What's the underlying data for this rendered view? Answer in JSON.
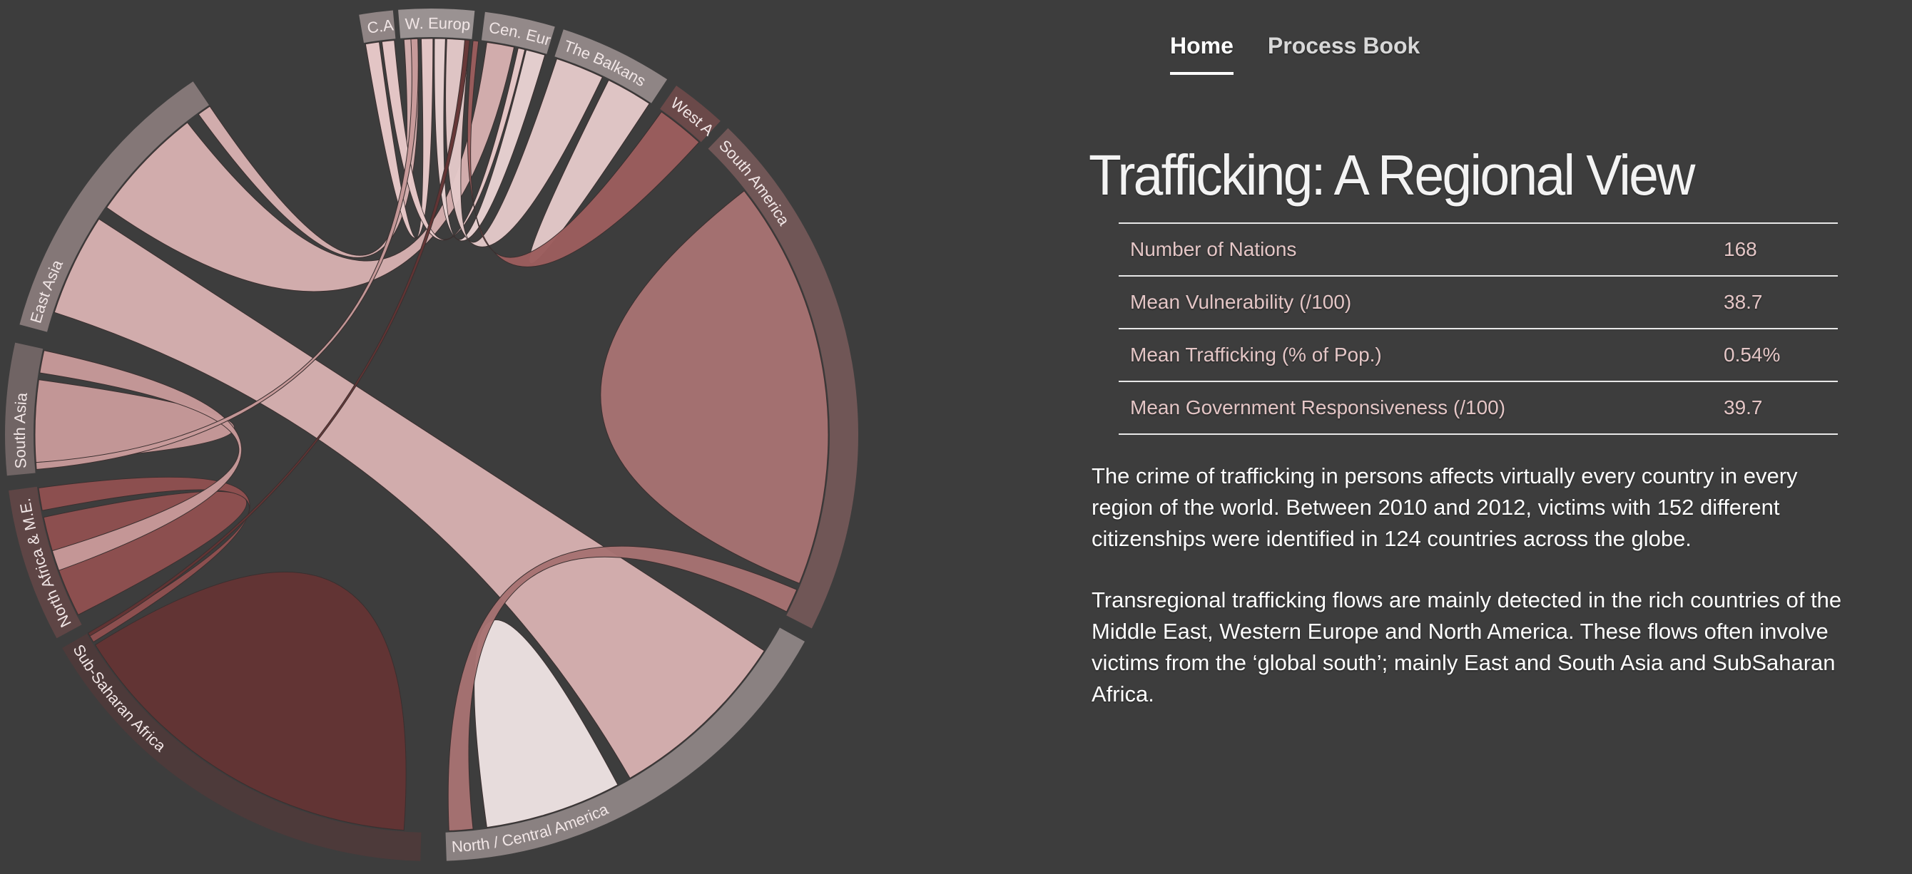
{
  "nav": {
    "items": [
      {
        "label": "Home",
        "active": true
      },
      {
        "label": "Process Book",
        "active": false
      }
    ]
  },
  "title": "Trafficking: A Regional View",
  "stats": [
    {
      "label": "Number of Nations",
      "value": "168"
    },
    {
      "label": "Mean Vulnerability (/100)",
      "value": "38.7"
    },
    {
      "label": "Mean Trafficking (% of Pop.)",
      "value": "0.54%"
    },
    {
      "label": "Mean Government Responsiveness (/100)",
      "value": "39.7"
    }
  ],
  "paragraphs": [
    "The crime of trafficking in persons affects virtually every country in every region of the world. Between 2010 and 2012, victims with 152 different citizenships were identified in 124 countries across the globe.",
    "Transregional trafficking flows are mainly detected in the rich countries of the Middle East, Western Europe and North America. These flows often involve victims from the ‘global south’; mainly East and South Asia and SubSaharan Africa."
  ],
  "chart_data": {
    "type": "chord",
    "groups": [
      {
        "label": "C.Asia",
        "color": "#e8c9c9",
        "ring": "#8f8484"
      },
      {
        "label": "W. Europe",
        "color": "#f5eeee",
        "ring": "#9a9292"
      },
      {
        "label": "Cen. Europe",
        "color": "#e8d2d2",
        "ring": "#938989"
      },
      {
        "label": "The Balkans",
        "color": "#e3c8c8",
        "ring": "#8f8585"
      },
      {
        "label": "West Africa",
        "color": "#9b5d5d",
        "ring": "#6a4949"
      },
      {
        "label": "South America",
        "color": "#a67272",
        "ring": "#705656"
      },
      {
        "label": "North / Central America",
        "color": "#ece1e1",
        "ring": "#8a8181"
      },
      {
        "label": "Sub-Saharan Africa",
        "color": "#633434",
        "ring": "#4d3a3a"
      },
      {
        "label": "North Africa & M.E.",
        "color": "#8e4f4f",
        "ring": "#5e4545"
      },
      {
        "label": "South Asia",
        "color": "#c69999",
        "ring": "#706464"
      },
      {
        "label": "East Asia",
        "color": "#d6b0b0",
        "ring": "#847777"
      }
    ],
    "ribbons": [
      {
        "source": "East Asia",
        "target": "Cen. Europe"
      },
      {
        "source": "East Asia",
        "target": "North / Central America"
      },
      {
        "source": "East Asia",
        "target": "W. Europe"
      },
      {
        "source": "C.Asia",
        "target": "W. Europe"
      },
      {
        "source": "C.Asia",
        "target": "Cen. Europe"
      },
      {
        "source": "Cen. Europe",
        "target": "W. Europe"
      },
      {
        "source": "The Balkans",
        "target": "W. Europe"
      },
      {
        "source": "The Balkans",
        "target": "The Balkans"
      },
      {
        "source": "West Africa",
        "target": "W. Europe"
      },
      {
        "source": "South America",
        "target": "South America"
      },
      {
        "source": "South America",
        "target": "North / Central America"
      },
      {
        "source": "North / Central America",
        "target": "North / Central America"
      },
      {
        "source": "Sub-Saharan Africa",
        "target": "Sub-Saharan Africa"
      },
      {
        "source": "North Africa & M.E.",
        "target": "North Africa & M.E."
      },
      {
        "source": "North Africa & M.E.",
        "target": "Sub-Saharan Africa"
      },
      {
        "source": "South Asia",
        "target": "South Asia"
      },
      {
        "source": "South Asia",
        "target": "North Africa & M.E."
      },
      {
        "source": "East Asia",
        "target": "East Asia"
      },
      {
        "source": "South Asia",
        "target": "W. Europe"
      },
      {
        "source": "Sub-Saharan Africa",
        "target": "W. Europe"
      }
    ]
  }
}
